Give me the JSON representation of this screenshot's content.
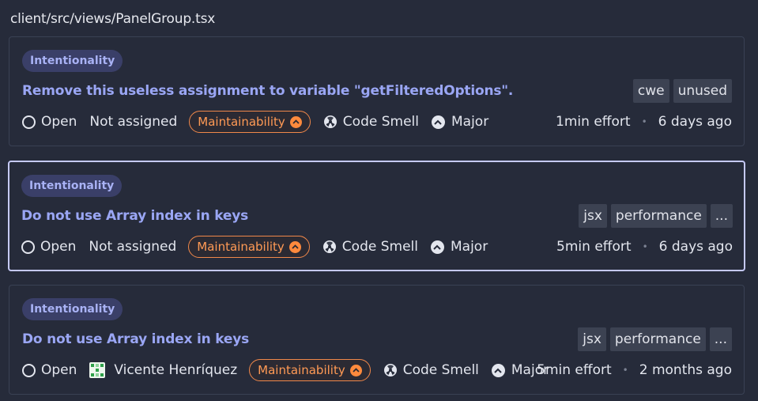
{
  "file_path": "client/src/views/PanelGroup.tsx",
  "issues": [
    {
      "badge": "Intentionality",
      "title": "Remove this useless assignment to variable \"getFilteredOptions\".",
      "tags": [
        "cwe",
        "unused"
      ],
      "status": "Open",
      "assignee": "Not assigned",
      "quality": "Maintainability",
      "type": "Code Smell",
      "severity": "Major",
      "effort": "1min effort",
      "age": "6 days ago",
      "selected": false
    },
    {
      "badge": "Intentionality",
      "title": "Do not use Array index in keys",
      "tags": [
        "jsx",
        "performance",
        "..."
      ],
      "status": "Open",
      "assignee": "Not assigned",
      "quality": "Maintainability",
      "type": "Code Smell",
      "severity": "Major",
      "effort": "5min effort",
      "age": "6 days ago",
      "selected": true
    },
    {
      "badge": "Intentionality",
      "title": "Do not use Array index in keys",
      "tags": [
        "jsx",
        "performance",
        "..."
      ],
      "status": "Open",
      "assignee": "Vicente Henríquez",
      "quality": "Maintainability",
      "type": "Code Smell",
      "severity": "Major",
      "effort": "5min effort",
      "age": "2 months ago",
      "selected": false
    }
  ],
  "separator": "•",
  "colors": {
    "background": "#262b3a",
    "title": "#9aa6f4",
    "badge_bg": "#3a3f68",
    "quality_accent": "#ff9a55",
    "selected_border": "#c5c9f7"
  }
}
